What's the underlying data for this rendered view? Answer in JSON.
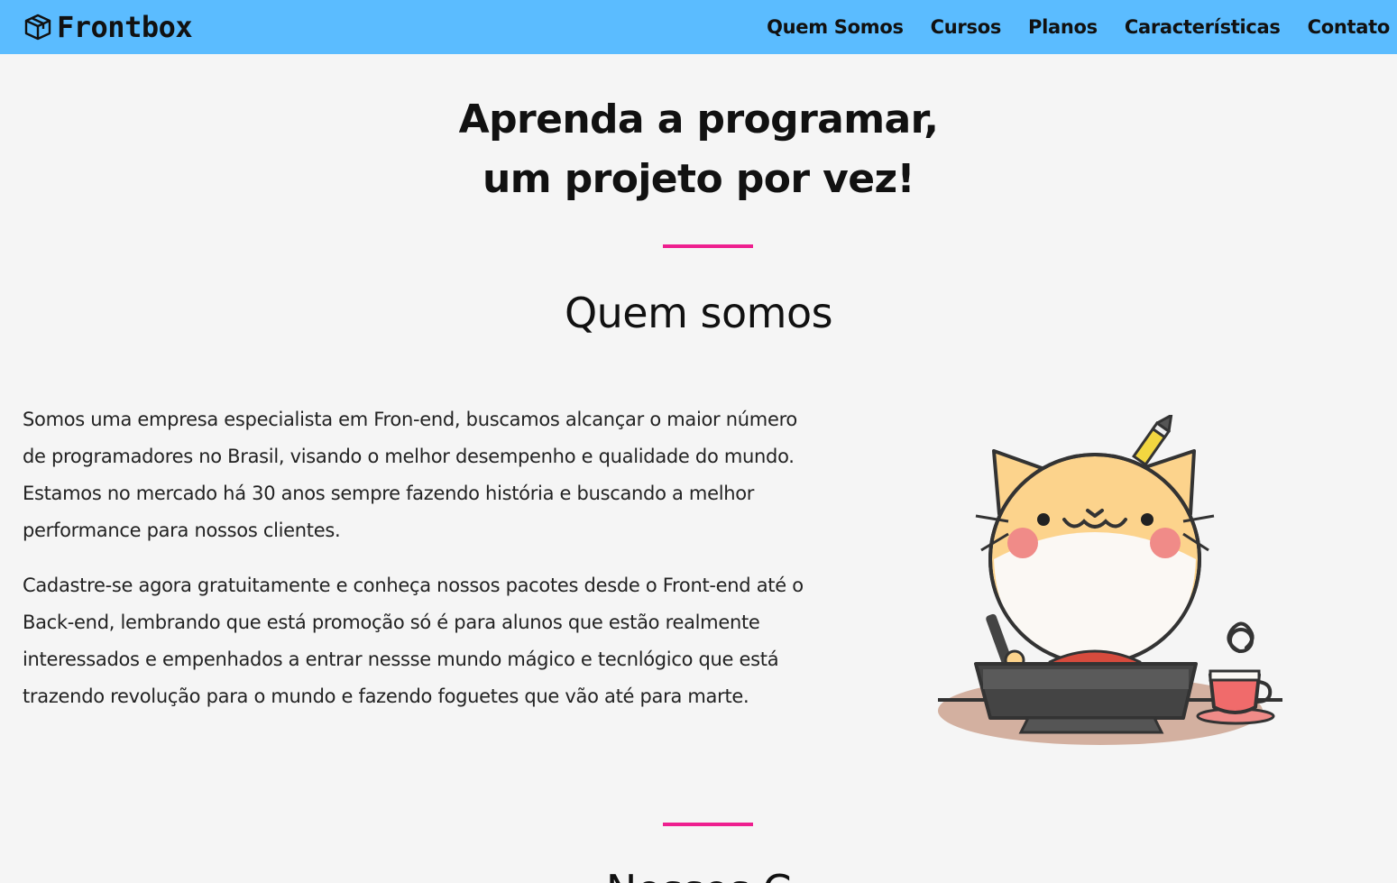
{
  "header": {
    "brand": "Frontbox",
    "nav": [
      "Quem Somos",
      "Cursos",
      "Planos",
      "Características",
      "Contato"
    ]
  },
  "hero": {
    "line1": "Aprenda a programar,",
    "line2": "um projeto por vez!"
  },
  "about": {
    "title": "Quem somos",
    "paragraph1": "Somos uma empresa especialista em Fron-end, buscamos alcançar o maior número de programadores no Brasil, visando o melhor desempenho e qualidade do mundo. Estamos no mercado há 30 anos sempre fazendo história e buscando a melhor performance para nossos clientes.",
    "paragraph2": "Cadastre-se agora gratuitamente e conheça nossos pacotes desde o Front-end até o Back-end, lembrando que está promoção só é para alunos que estão realmente interessados e empenhados a entrar nessse mundo mágico e tecnlógico que está trazendo revolução para o mundo e fazendo foguetes que vão até para marte."
  },
  "next_section": {
    "title_partial": "Nossos C"
  },
  "colors": {
    "header_bg": "#5bbcff",
    "accent": "#ee1f8f",
    "page_bg": "#f5f5f5"
  }
}
